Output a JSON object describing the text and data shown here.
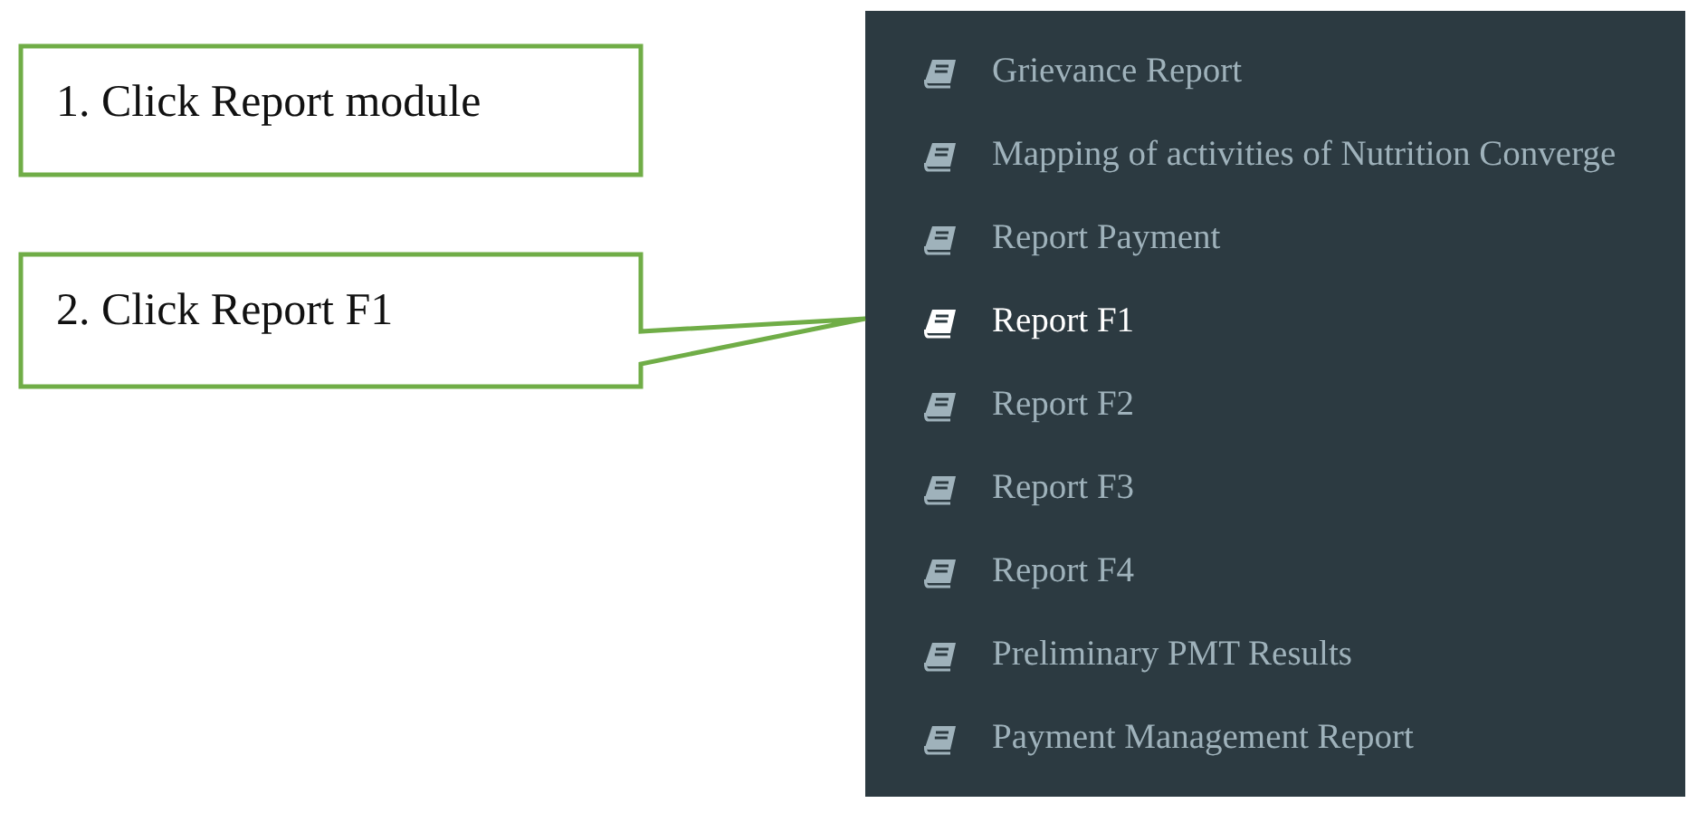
{
  "callouts": [
    {
      "text": "1. Click Report module",
      "pointer": false
    },
    {
      "text": "2. Click Report F1",
      "pointer": true
    }
  ],
  "sidebar": {
    "items": [
      {
        "label": "Grievance Report",
        "selected": false
      },
      {
        "label": "Mapping of activities of Nutrition Converge",
        "selected": false
      },
      {
        "label": "Report Payment",
        "selected": false
      },
      {
        "label": "Report F1",
        "selected": true
      },
      {
        "label": "Report F2",
        "selected": false
      },
      {
        "label": "Report F3",
        "selected": false
      },
      {
        "label": "Report F4",
        "selected": false
      },
      {
        "label": "Preliminary PMT Results",
        "selected": false
      },
      {
        "label": "Payment Management Report",
        "selected": false
      }
    ]
  }
}
